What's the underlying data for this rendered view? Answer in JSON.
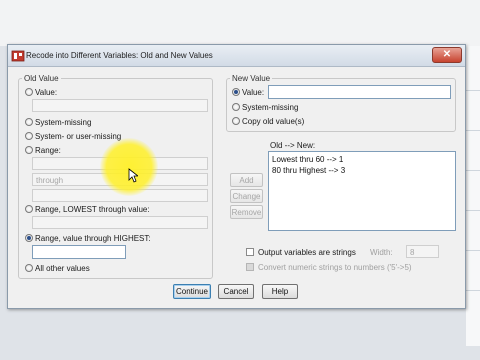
{
  "window": {
    "title": "Recode into Different Variables: Old and New Values",
    "close_glyph": "✕"
  },
  "old_value": {
    "group_label": "Old Value",
    "options": {
      "value": "Value:",
      "system_missing": "System-missing",
      "system_or_user_missing": "System- or user-missing",
      "range": "Range:",
      "range_through": "through",
      "range_lowest": "Range, LOWEST through value:",
      "range_highest": "Range, value through HIGHEST:",
      "all_other": "All other values"
    },
    "selected": "range_highest",
    "range_highest_input": ""
  },
  "new_value": {
    "group_label": "New Value",
    "options": {
      "value": "Value:",
      "system_missing": "System-missing",
      "copy_old": "Copy old value(s)"
    },
    "selected": "value",
    "value_input": ""
  },
  "mapping": {
    "label": "Old --> New:",
    "items": [
      "Lowest thru 60 --> 1",
      "80 thru Highest --> 3"
    ],
    "add_label": "Add",
    "change_label": "Change",
    "remove_label": "Remove"
  },
  "output_options": {
    "strings_label": "Output variables are strings",
    "strings_checked": false,
    "width_label": "Width:",
    "width_value": "8",
    "convert_label": "Convert numeric strings to numbers ('5'->5)",
    "convert_checked": false
  },
  "buttons": {
    "continue": "Continue",
    "cancel": "Cancel",
    "help": "Help"
  },
  "colors": {
    "accent": "#2c4f8a",
    "highlight": "#fff028"
  }
}
